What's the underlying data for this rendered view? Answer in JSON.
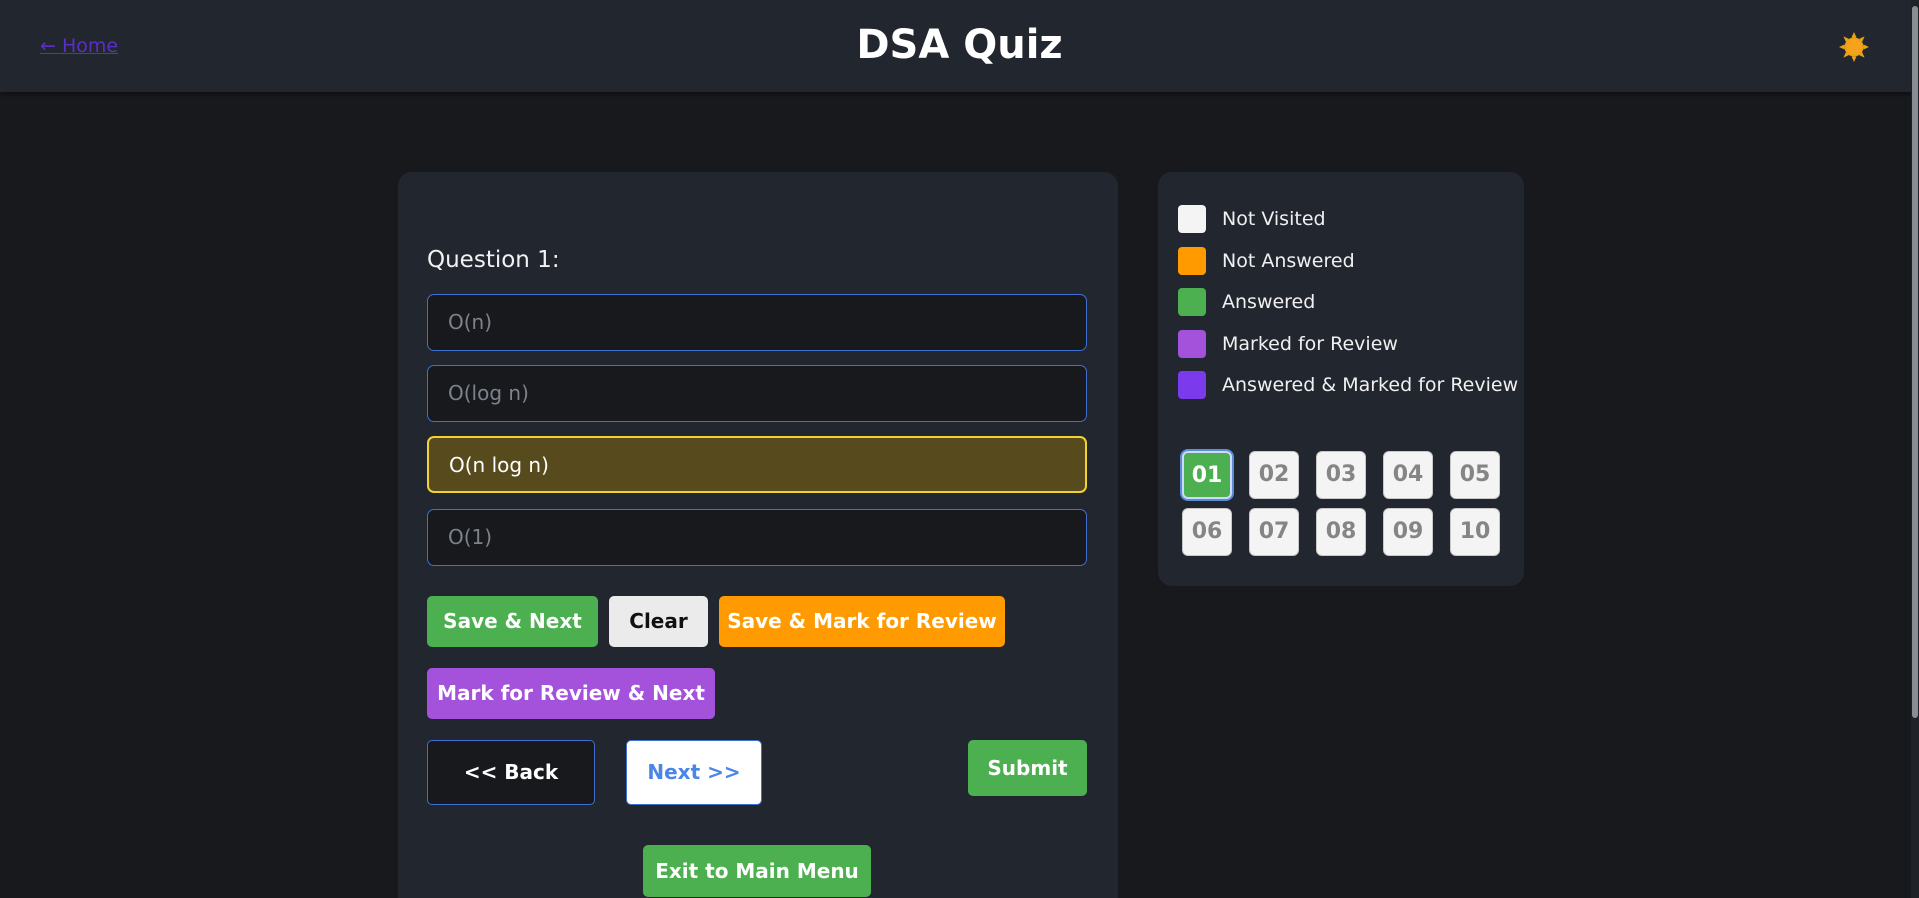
{
  "header": {
    "home_link": "← Home",
    "title": "DSA Quiz",
    "theme_icon": "sun-icon"
  },
  "question": {
    "label": "Question 1:",
    "options": [
      "O(n)",
      "O(log n)",
      "O(n log n)",
      "O(1)"
    ],
    "selected_option": "O(n log n)"
  },
  "actions": {
    "save_next": "Save & Next",
    "clear": "Clear",
    "save_mark_review": "Save & Mark for Review",
    "mark_review_next": "Mark for Review & Next",
    "back": "<< Back",
    "next": "Next >>",
    "submit": "Submit",
    "exit": "Exit to Main Menu"
  },
  "legend": [
    {
      "label": "Not Visited",
      "color": "#f4f4f5"
    },
    {
      "label": "Not Answered",
      "color": "#ff9a00"
    },
    {
      "label": "Answered",
      "color": "#4caf50"
    },
    {
      "label": "Marked for Review",
      "color": "#a451dc"
    },
    {
      "label": "Answered & Marked for Review",
      "color": "#7c3aed"
    }
  ],
  "question_numbers": [
    "01",
    "02",
    "03",
    "04",
    "05",
    "06",
    "07",
    "08",
    "09",
    "10"
  ],
  "current_question": "01",
  "colors": {
    "accent_green": "#4caf50",
    "accent_orange": "#ff9a00",
    "accent_purple": "#a451dc",
    "selected_option_border": "#f1d232"
  }
}
